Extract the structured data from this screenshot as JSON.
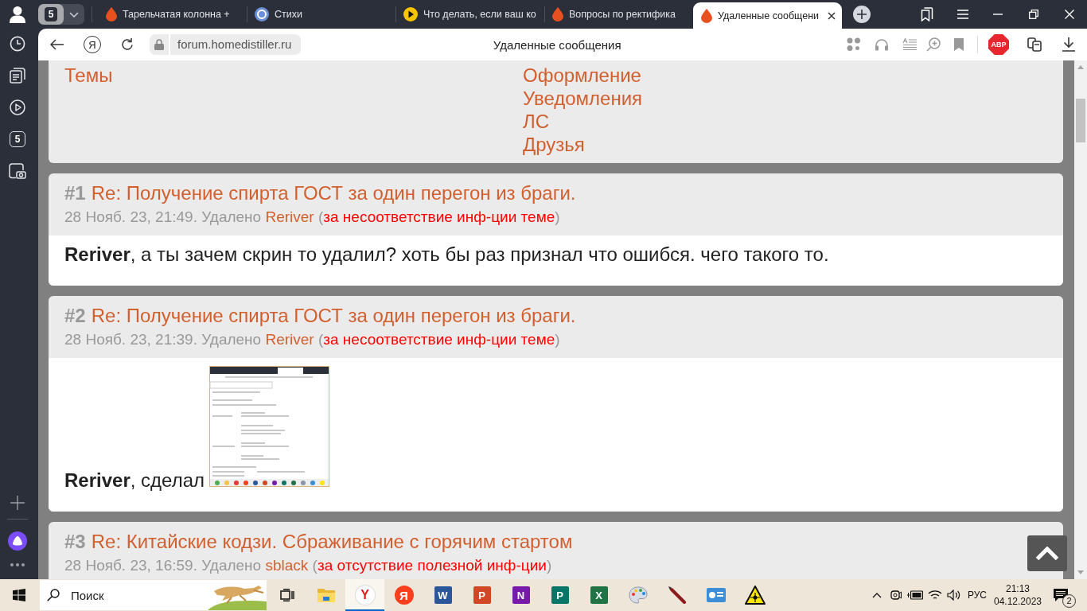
{
  "browser": {
    "tab_group": {
      "count": "5"
    },
    "tabs": [
      {
        "title": "Тарельчатая колонна +",
        "kind": "forum",
        "selected": false
      },
      {
        "title": "Стихи",
        "kind": "poems",
        "selected": false
      },
      {
        "title": "Что делать, если ваш ко",
        "kind": "video",
        "selected": false
      },
      {
        "title": "Вопросы по ректифика",
        "kind": "forum",
        "selected": false
      },
      {
        "title": "Удаленные сообщени",
        "kind": "forum",
        "selected": true
      }
    ]
  },
  "address_bar": {
    "logo_button": "Я",
    "url": "forum.homedistiller.ru",
    "page_title": "Удаленные сообщения",
    "adblock_label": "ABP"
  },
  "sidebar": {
    "tab_count": "5"
  },
  "page": {
    "nav": {
      "left": [
        "Темы"
      ],
      "right": [
        "Оформление",
        "Уведомления",
        "ЛС",
        "Друзья"
      ]
    },
    "posts": [
      {
        "number": "#1",
        "title": "Re: Получение спирта ГОСТ за один перегон из браги.",
        "meta": [
          {
            "kind": "text",
            "text": "28 Нояб. 23, 21:49. Удалено "
          },
          {
            "kind": "user",
            "text": "Reriver"
          },
          {
            "kind": "text",
            "text": " ("
          },
          {
            "kind": "reason",
            "text": "за несоответствие инф-ции теме"
          },
          {
            "kind": "text",
            "text": ")"
          }
        ],
        "body": "**Reriver**, а ты зачем скрин то удалил? хоть бы раз признал что ошибся. чего такого то."
      },
      {
        "number": "#2",
        "title": "Re: Получение спирта ГОСТ за один перегон из браги.",
        "meta": [
          {
            "kind": "text",
            "text": "28 Нояб. 23, 21:39. Удалено "
          },
          {
            "kind": "user",
            "text": "Reriver"
          },
          {
            "kind": "text",
            "text": " ("
          },
          {
            "kind": "reason",
            "text": "за несоответствие инф-ции теме"
          },
          {
            "kind": "text",
            "text": ")"
          }
        ],
        "body": "**Reriver**, сделал",
        "attachments": [
          {
            "kind": "screenshot"
          }
        ]
      },
      {
        "number": "#3",
        "title": "Re: Китайские кодзи. Сбраживание с горячим стартом",
        "meta": [
          {
            "kind": "text",
            "text": "28 Нояб. 23, 16:59. Удалено "
          },
          {
            "kind": "user",
            "text": "sblack"
          },
          {
            "kind": "text",
            "text": " ("
          },
          {
            "kind": "reason",
            "text": "за отсутствие полезной инф-ции"
          },
          {
            "kind": "text",
            "text": ")"
          }
        ]
      }
    ]
  },
  "taskbar": {
    "search": {
      "placeholder": "Поиск"
    },
    "apps": [
      {
        "kind": "folder",
        "selected": false
      },
      {
        "kind": "browser",
        "label": "Y",
        "selected": true
      },
      {
        "kind": "yandex",
        "label": "Я",
        "selected": false
      },
      {
        "kind": "word",
        "label": "W",
        "selected": false
      },
      {
        "kind": "powerpoint",
        "label": "P",
        "selected": false
      },
      {
        "kind": "onenote",
        "label": "N",
        "selected": false
      },
      {
        "kind": "publisher",
        "label": "P",
        "selected": false
      },
      {
        "kind": "excel",
        "label": "X",
        "selected": false
      },
      {
        "kind": "palette",
        "selected": false
      },
      {
        "kind": "pencil",
        "selected": false
      },
      {
        "kind": "screen",
        "selected": false
      },
      {
        "kind": "warning",
        "selected": false
      }
    ],
    "tray": {
      "language": "РУС",
      "time": "21:13",
      "date": "04.12.2023",
      "notifications": "2"
    }
  }
}
